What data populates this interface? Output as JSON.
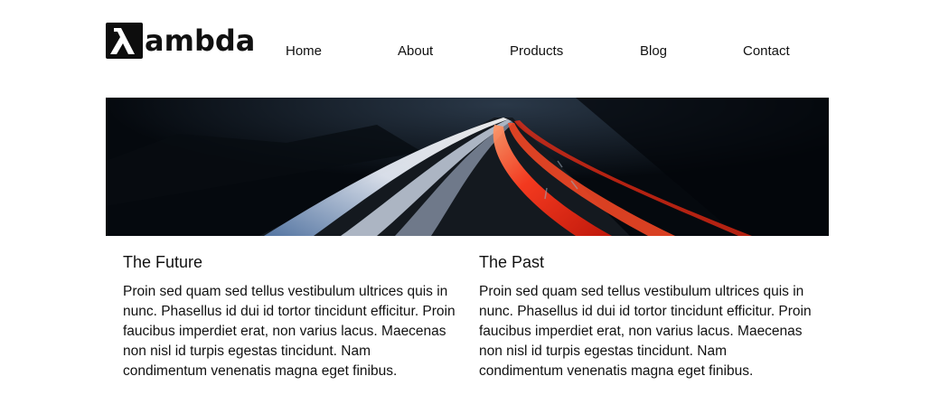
{
  "logo": {
    "glyph": "λ",
    "text": "ambda"
  },
  "nav": {
    "items": [
      {
        "label": "Home"
      },
      {
        "label": "About"
      },
      {
        "label": "Products"
      },
      {
        "label": "Blog"
      },
      {
        "label": "Contact"
      }
    ]
  },
  "hero": {
    "description": "night highway light trails"
  },
  "columns": [
    {
      "title": "The Future",
      "body": "Proin sed quam sed tellus vestibulum ultrices quis in nunc. Phasellus id dui id tortor tincidunt efficitur. Proin faucibus imperdiet erat, non varius lacus. Maecenas non nisl id turpis egestas tincidunt. Nam condimentum venenatis magna eget finibus."
    },
    {
      "title": "The Past",
      "body": "Proin sed quam sed tellus vestibulum ultrices quis in nunc. Phasellus id dui id tortor tincidunt efficitur. Proin faucibus imperdiet erat, non varius lacus. Maecenas non nisl id turpis egestas tincidunt. Nam condimentum venenatis magna eget finibus."
    }
  ],
  "colors": {
    "text": "#111111",
    "background": "#ffffff",
    "hero_dark": "#05090e",
    "trail_red": "#ff3b1f",
    "trail_white": "#e8f0ff"
  }
}
